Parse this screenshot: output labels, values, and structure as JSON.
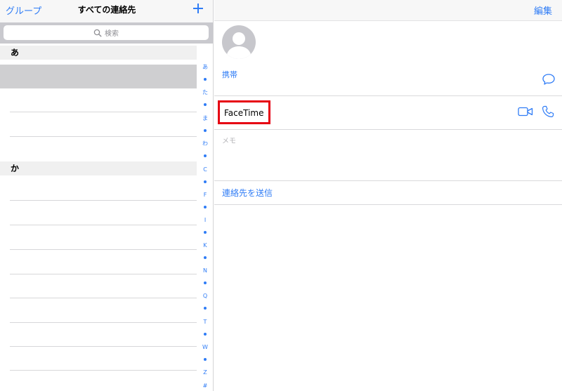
{
  "left_panel": {
    "groups_button": "グループ",
    "title": "すべての連絡先",
    "search_placeholder": "検索",
    "sections": [
      {
        "header": "あ"
      },
      {
        "header": "か"
      }
    ],
    "index_letters": [
      "あ",
      "た",
      "ま",
      "わ",
      "C",
      "F",
      "I",
      "K",
      "N",
      "Q",
      "T",
      "W",
      "Z",
      "#"
    ]
  },
  "detail": {
    "edit_button": "編集",
    "mobile_label": "携帯",
    "facetime_label": "FaceTime",
    "memo_label": "メモ",
    "send_contact_label": "連絡先を送信"
  },
  "colors": {
    "accent": "#2f7cf6",
    "highlight": "#e60012",
    "selected_row": "#cfcfd1",
    "search_bg": "#c9c9ce"
  }
}
